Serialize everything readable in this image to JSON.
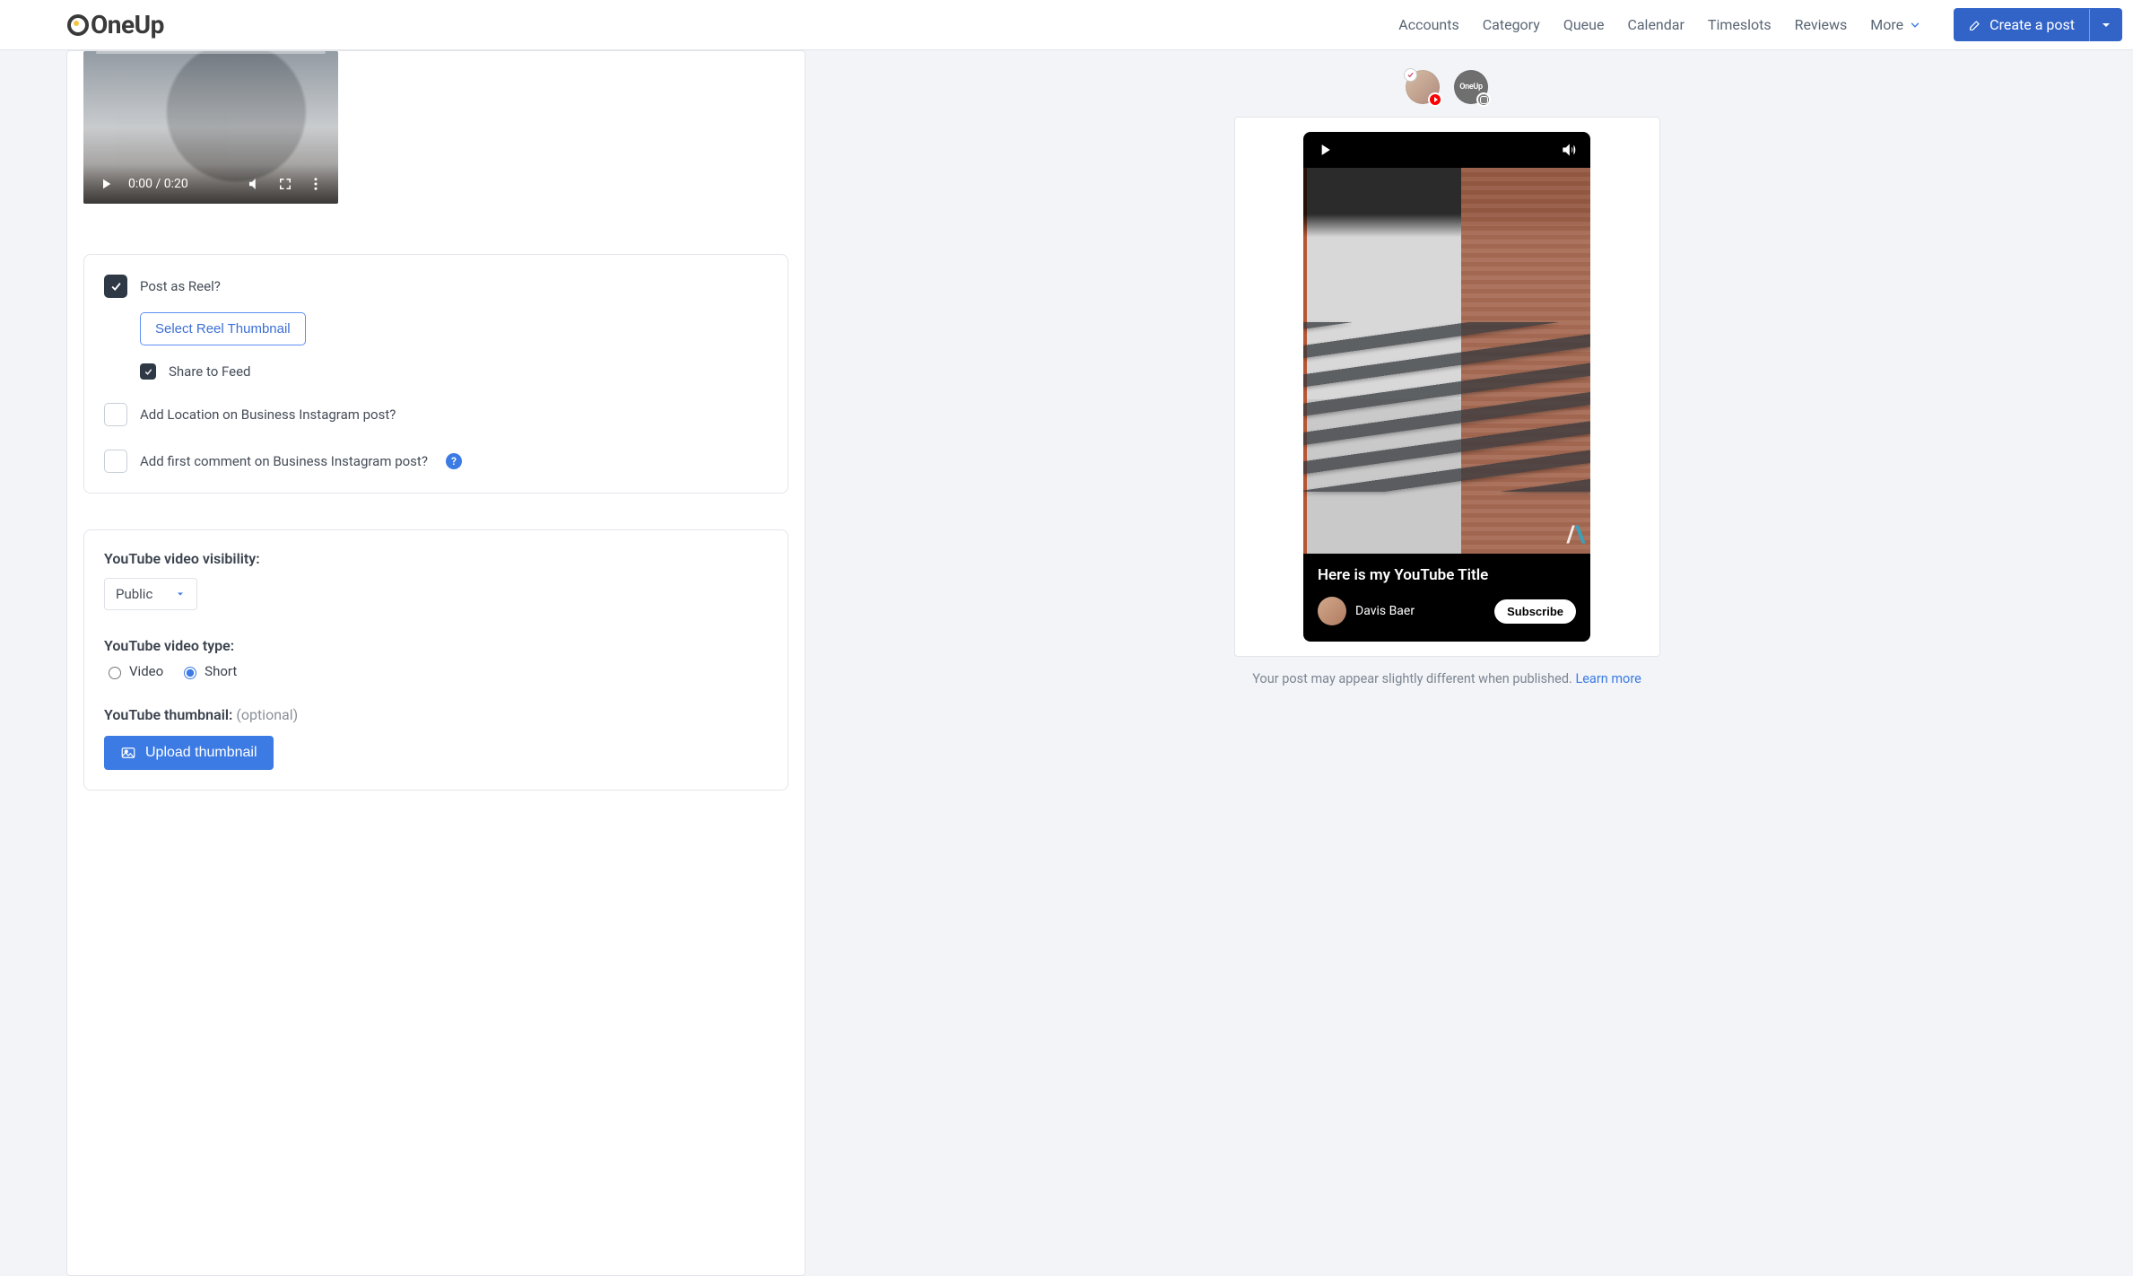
{
  "brand": "OneUp",
  "nav": {
    "accounts": "Accounts",
    "category": "Category",
    "queue": "Queue",
    "calendar": "Calendar",
    "timeslots": "Timeslots",
    "reviews": "Reviews",
    "more": "More",
    "create_post": "Create a post"
  },
  "player": {
    "time": "0:00 / 0:20"
  },
  "instagram": {
    "post_as_reel_label": "Post as Reel?",
    "select_reel_thumbnail": "Select Reel Thumbnail",
    "share_to_feed": "Share to Feed",
    "add_location": "Add Location on Business Instagram post?",
    "add_first_comment": "Add first comment on Business Instagram post?"
  },
  "youtube": {
    "visibility_label": "YouTube video visibility:",
    "visibility_value": "Public",
    "type_label": "YouTube video type:",
    "type_video": "Video",
    "type_short": "Short",
    "thumbnail_label": "YouTube thumbnail:",
    "thumbnail_optional": " (optional)",
    "upload_thumbnail": "Upload thumbnail"
  },
  "accounts": {
    "oneup_label": "OneUp"
  },
  "preview": {
    "video_title": "Here is my YouTube Title",
    "author": "Davis Baer",
    "subscribe": "Subscribe",
    "disclaimer_text": "Your post may appear slightly different when published. ",
    "disclaimer_link": "Learn more"
  }
}
